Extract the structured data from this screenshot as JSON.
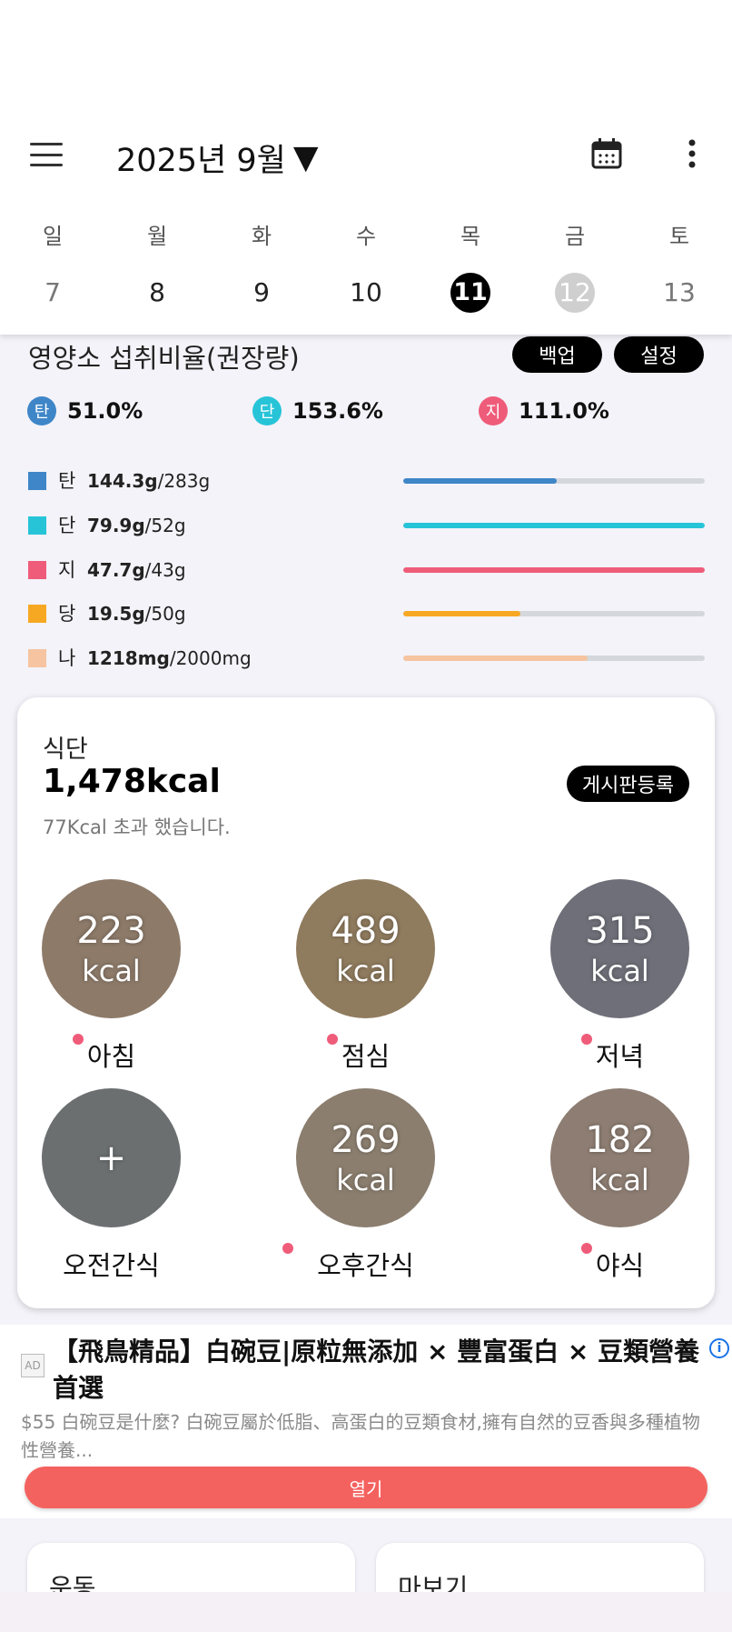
{
  "header": {
    "month_title": "2025년 9월",
    "dropdown_arrow": "▼"
  },
  "week": [
    {
      "dow": "일",
      "date": "7",
      "state": "muted"
    },
    {
      "dow": "월",
      "date": "8",
      "state": "normal"
    },
    {
      "dow": "화",
      "date": "9",
      "state": "normal"
    },
    {
      "dow": "수",
      "date": "10",
      "state": "normal"
    },
    {
      "dow": "목",
      "date": "11",
      "state": "selected"
    },
    {
      "dow": "금",
      "date": "12",
      "state": "today"
    },
    {
      "dow": "토",
      "date": "13",
      "state": "muted"
    }
  ],
  "nutrition": {
    "title": "영양소 섭취비율(권장량)",
    "backup_label": "백업",
    "settings_label": "설정",
    "ratios": [
      {
        "badge": "탄",
        "value": "51.0%",
        "color": "#3f86c8"
      },
      {
        "badge": "단",
        "value": "153.6%",
        "color": "#27c4d8"
      },
      {
        "badge": "지",
        "value": "111.0%",
        "color": "#ef5c7a"
      }
    ],
    "rows": [
      {
        "label": "탄",
        "amount": "144.3g",
        "goal": "/283g",
        "color": "#3f86c8",
        "fill": 0.51
      },
      {
        "label": "단",
        "amount": "79.9g",
        "goal": "/52g",
        "color": "#27c4d8",
        "fill": 1.0
      },
      {
        "label": "지",
        "amount": "47.7g",
        "goal": "/43g",
        "color": "#ef5c7a",
        "fill": 1.0
      },
      {
        "label": "당",
        "amount": "19.5g",
        "goal": "/50g",
        "color": "#f7a823",
        "fill": 0.39
      },
      {
        "label": "나",
        "amount": "1218mg",
        "goal": "/2000mg",
        "color": "#f6c4a0",
        "fill": 0.61
      }
    ]
  },
  "diet": {
    "label": "식단",
    "total_kcal": "1,478kcal",
    "note": "77Kcal 초과 했습니다.",
    "board_label": "게시판등록",
    "meals": [
      {
        "kcal": "223",
        "unit": "kcal",
        "name": "아침",
        "color": "#8d7a69",
        "dot": true
      },
      {
        "kcal": "489",
        "unit": "kcal",
        "name": "점심",
        "color": "#8f7b5e",
        "dot": true
      },
      {
        "kcal": "315",
        "unit": "kcal",
        "name": "저녁",
        "color": "#6e6f78",
        "dot": true
      },
      {
        "kcal": "+",
        "unit": "",
        "name": "오전간식",
        "color": "#6b6f70",
        "dot": false
      },
      {
        "kcal": "269",
        "unit": "kcal",
        "name": "오후간식",
        "color": "#8b7e6f",
        "dot": true
      },
      {
        "kcal": "182",
        "unit": "kcal",
        "name": "야식",
        "color": "#8d7d72",
        "dot": true
      }
    ]
  },
  "ad": {
    "badge": "AD",
    "title": "【飛鳥精品】白碗豆|原粒無添加 × 豐富蛋白 × 豆類營養首選",
    "description": "$55 白碗豆是什麼? 白碗豆屬於低脂、高蛋白的豆類食材,擁有自然的豆香與多種植物性營養...",
    "open_label": "열기"
  },
  "bottom_cards": [
    {
      "label": "운동"
    },
    {
      "label": "마보기"
    }
  ]
}
